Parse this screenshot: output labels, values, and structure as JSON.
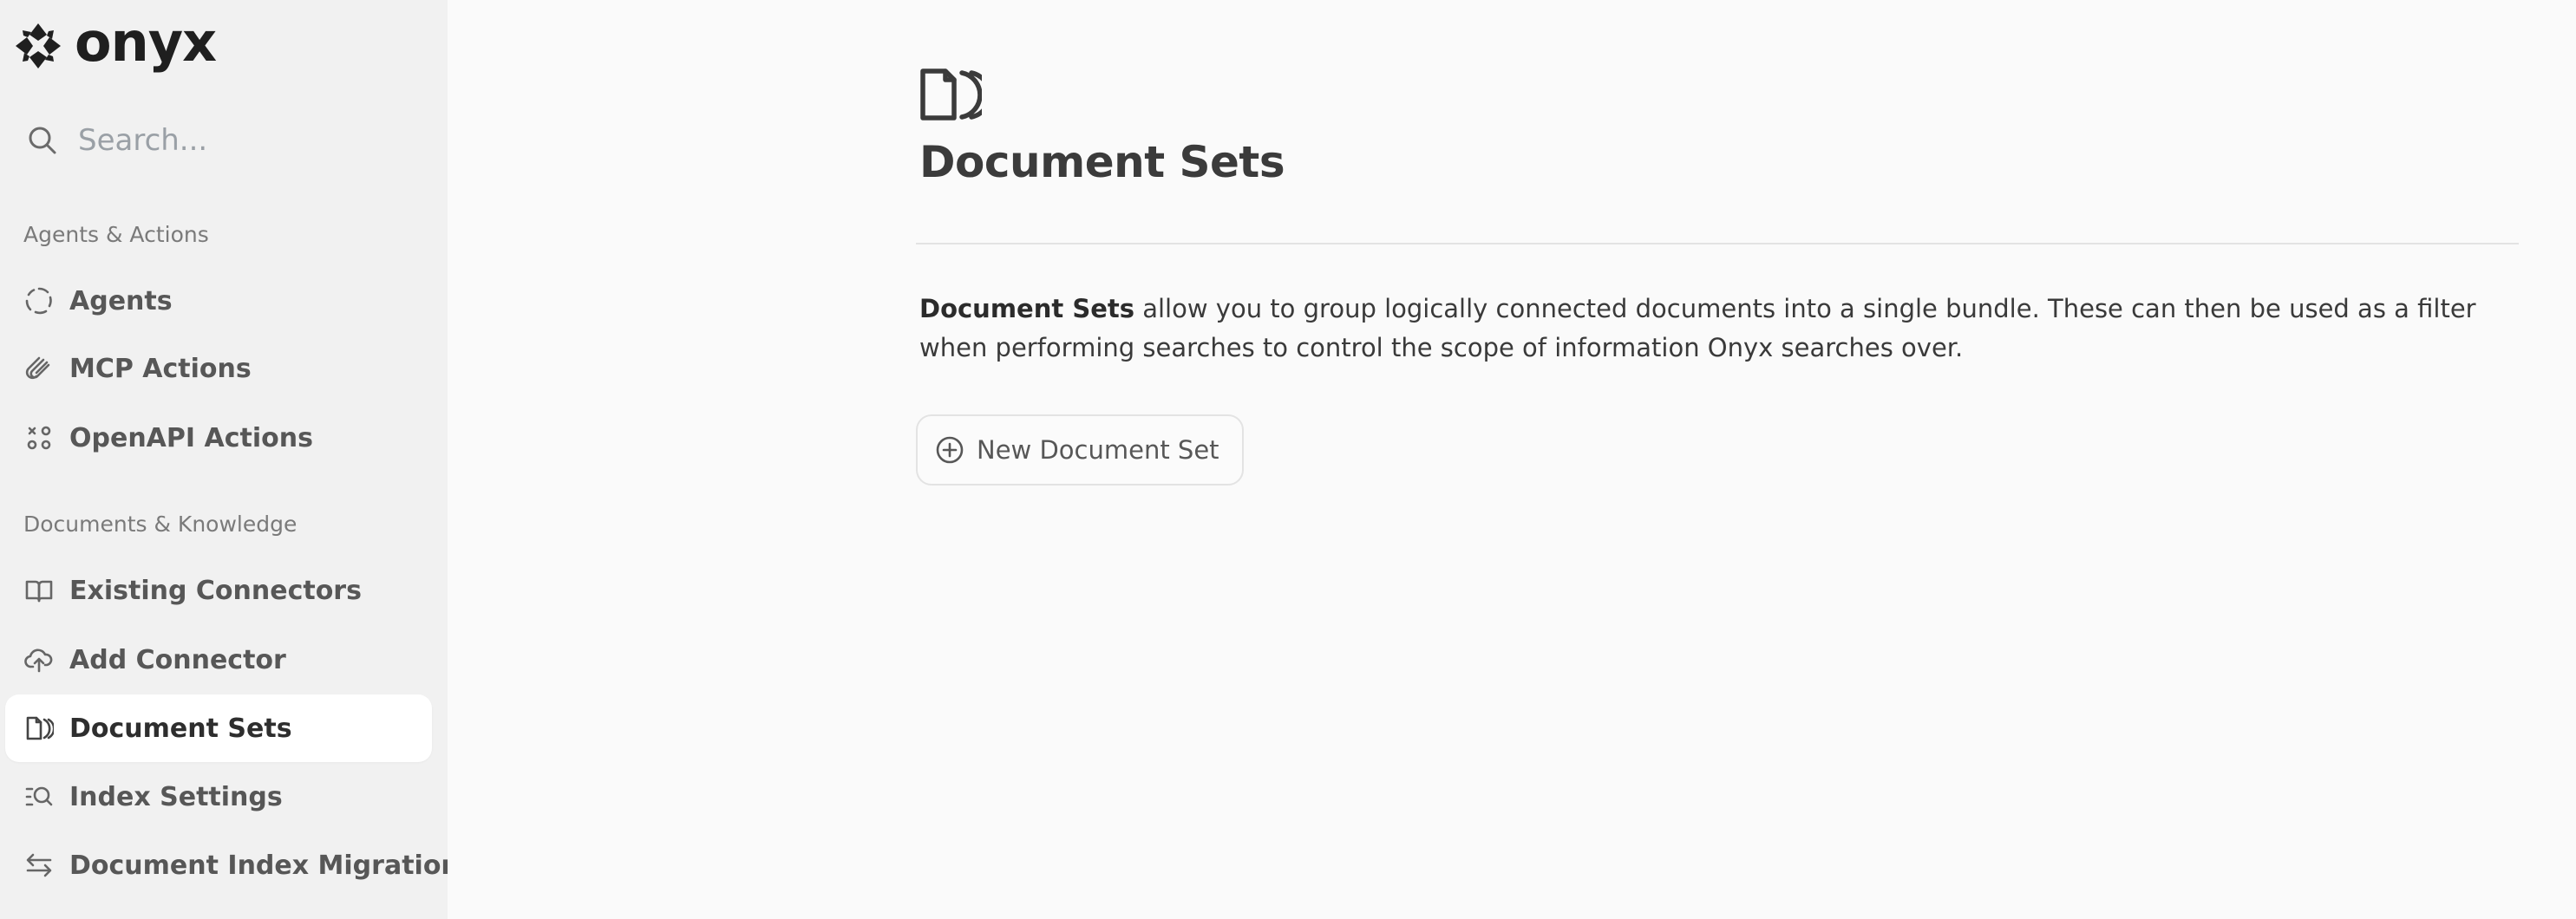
{
  "brand": {
    "name": "onyx"
  },
  "search": {
    "placeholder": "Search..."
  },
  "sidebar": {
    "sections": [
      {
        "label": "Agents & Actions",
        "items": [
          {
            "label": "Agents",
            "icon": "agents-circle-icon"
          },
          {
            "label": "MCP Actions",
            "icon": "paperclip-icon"
          },
          {
            "label": "OpenAPI Actions",
            "icon": "actions-nodes-icon"
          }
        ]
      },
      {
        "label": "Documents & Knowledge",
        "items": [
          {
            "label": "Existing Connectors",
            "icon": "open-book-icon"
          },
          {
            "label": "Add Connector",
            "icon": "cloud-upload-icon"
          },
          {
            "label": "Document Sets",
            "icon": "document-stack-icon",
            "active": true
          },
          {
            "label": "Index Settings",
            "icon": "list-search-icon"
          },
          {
            "label": "Document Index Migration",
            "icon": "swap-arrows-icon"
          }
        ]
      }
    ]
  },
  "main": {
    "title": "Document Sets",
    "icon": "document-stack-icon",
    "description": {
      "strong": "Document Sets",
      "rest": " allow you to group logically connected documents into a single bundle. These can then be used as a filter when performing searches to control the scope of information Onyx searches over."
    },
    "new_button": {
      "label": "New Document Set",
      "icon": "plus-circle-icon"
    }
  },
  "colors": {
    "sidebar_bg": "#f1f1f1",
    "main_bg": "#fafafa",
    "active_item_bg": "#ffffff",
    "text": "#3a3a3a",
    "muted": "#7a7a7a"
  }
}
